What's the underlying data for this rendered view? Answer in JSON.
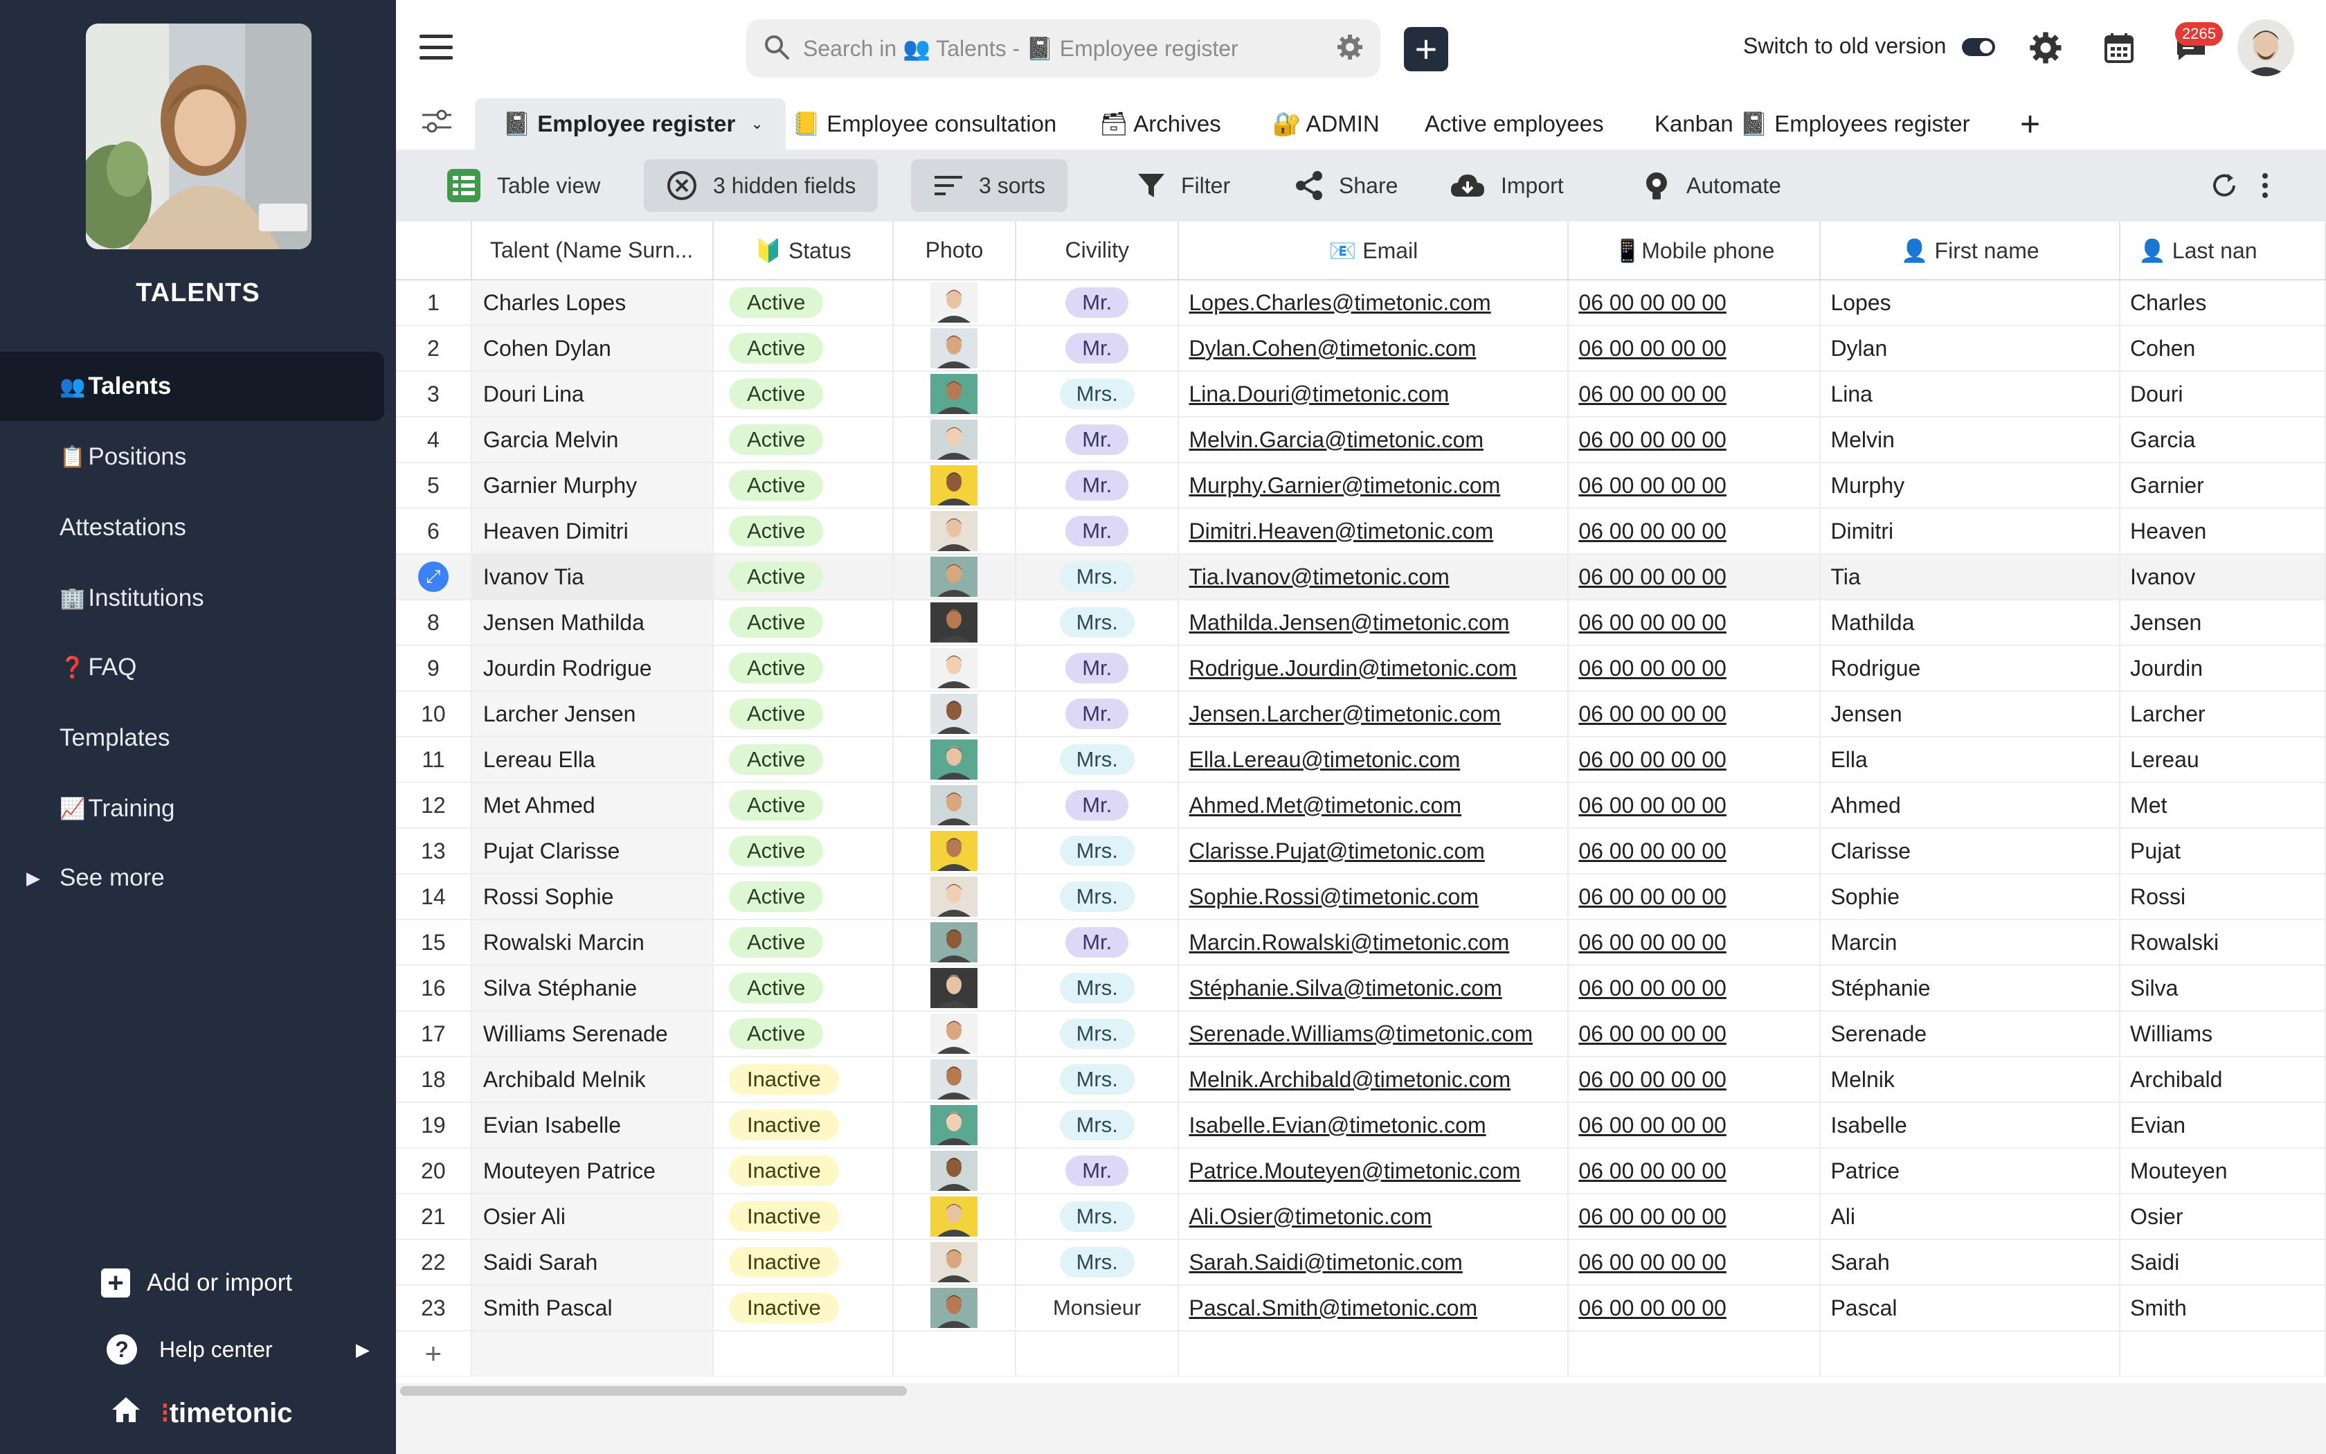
{
  "sidebar": {
    "app_title": "TALENTS",
    "items": [
      {
        "emoji": "👥",
        "label": "Talents"
      },
      {
        "emoji": "📋",
        "label": "Positions"
      },
      {
        "emoji": "",
        "label": "Attestations"
      },
      {
        "emoji": "🏢",
        "label": "Institutions"
      },
      {
        "emoji": "❓",
        "label": "FAQ"
      },
      {
        "emoji": "",
        "label": "Templates"
      },
      {
        "emoji": "📈",
        "label": "Training"
      },
      {
        "emoji": "",
        "label": "See more"
      }
    ],
    "add_import_label": "Add or import",
    "help_center_label": "Help center",
    "brand": "timetonic"
  },
  "header": {
    "search_placeholder": "Search in 👥 Talents - 📓 Employee register",
    "switch_label": "Switch to old version",
    "notification_count": "2265"
  },
  "tabs": [
    {
      "label": "📓 Employee register"
    },
    {
      "label": "📒 Employee consultation"
    },
    {
      "label": "🗃 Archives"
    },
    {
      "label": "🔐 ADMIN"
    },
    {
      "label": "Active employees"
    },
    {
      "label": "Kanban 📓 Employees register"
    }
  ],
  "toolbar": {
    "table_view": "Table view",
    "hidden_fields": "3 hidden fields",
    "sorts": "3 sorts",
    "filter": "Filter",
    "share": "Share",
    "import": "Import",
    "automate": "Automate"
  },
  "table": {
    "columns": [
      "Talent (Name Surn...",
      "🔰 Status",
      "Photo",
      "Civility",
      "📧 Email",
      "📱Mobile phone",
      "👤 First name",
      "👤 Last nan"
    ],
    "rows": [
      {
        "n": "1",
        "name": "Charles Lopes",
        "status": "Active",
        "civility": "Mr.",
        "email": "Lopes.Charles@timetonic.com",
        "phone": "06 00 00 00 00",
        "first": "Lopes",
        "last": "Charles"
      },
      {
        "n": "2",
        "name": "Cohen Dylan",
        "status": "Active",
        "civility": "Mr.",
        "email": "Dylan.Cohen@timetonic.com",
        "phone": "06 00 00 00 00",
        "first": "Dylan",
        "last": "Cohen"
      },
      {
        "n": "3",
        "name": "Douri Lina",
        "status": "Active",
        "civility": "Mrs.",
        "email": "Lina.Douri@timetonic.com",
        "phone": "06 00 00 00 00",
        "first": "Lina",
        "last": "Douri"
      },
      {
        "n": "4",
        "name": "Garcia Melvin",
        "status": "Active",
        "civility": "Mr.",
        "email": "Melvin.Garcia@timetonic.com",
        "phone": "06 00 00 00 00",
        "first": "Melvin",
        "last": "Garcia"
      },
      {
        "n": "5",
        "name": "Garnier Murphy",
        "status": "Active",
        "civility": "Mr.",
        "email": "Murphy.Garnier@timetonic.com",
        "phone": "06 00 00 00 00",
        "first": "Murphy",
        "last": "Garnier"
      },
      {
        "n": "6",
        "name": "Heaven Dimitri",
        "status": "Active",
        "civility": "Mr.",
        "email": "Dimitri.Heaven@timetonic.com",
        "phone": "06 00 00 00 00",
        "first": "Dimitri",
        "last": "Heaven"
      },
      {
        "n": "",
        "name": "Ivanov Tia",
        "status": "Active",
        "civility": "Mrs.",
        "email": "Tia.Ivanov@timetonic.com",
        "phone": "06 00 00 00 00",
        "first": "Tia",
        "last": "Ivanov",
        "highlight": true
      },
      {
        "n": "8",
        "name": "Jensen Mathilda",
        "status": "Active",
        "civility": "Mrs.",
        "email": "Mathilda.Jensen@timetonic.com",
        "phone": "06 00 00 00 00",
        "first": "Mathilda",
        "last": "Jensen"
      },
      {
        "n": "9",
        "name": "Jourdin Rodrigue",
        "status": "Active",
        "civility": "Mr.",
        "email": "Rodrigue.Jourdin@timetonic.com",
        "phone": "06 00 00 00 00",
        "first": "Rodrigue",
        "last": "Jourdin"
      },
      {
        "n": "10",
        "name": "Larcher Jensen",
        "status": "Active",
        "civility": "Mr.",
        "email": "Jensen.Larcher@timetonic.com",
        "phone": "06 00 00 00 00",
        "first": "Jensen",
        "last": "Larcher"
      },
      {
        "n": "11",
        "name": "Lereau Ella",
        "status": "Active",
        "civility": "Mrs.",
        "email": "Ella.Lereau@timetonic.com",
        "phone": "06 00 00 00 00",
        "first": "Ella",
        "last": "Lereau"
      },
      {
        "n": "12",
        "name": "Met Ahmed",
        "status": "Active",
        "civility": "Mr.",
        "email": "Ahmed.Met@timetonic.com",
        "phone": "06 00 00 00 00",
        "first": "Ahmed",
        "last": "Met"
      },
      {
        "n": "13",
        "name": "Pujat Clarisse",
        "status": "Active",
        "civility": "Mrs.",
        "email": "Clarisse.Pujat@timetonic.com",
        "phone": "06 00 00 00 00",
        "first": "Clarisse",
        "last": "Pujat"
      },
      {
        "n": "14",
        "name": "Rossi Sophie",
        "status": "Active",
        "civility": "Mrs.",
        "email": "Sophie.Rossi@timetonic.com",
        "phone": "06 00 00 00 00",
        "first": "Sophie",
        "last": "Rossi"
      },
      {
        "n": "15",
        "name": "Rowalski Marcin",
        "status": "Active",
        "civility": "Mr.",
        "email": "Marcin.Rowalski@timetonic.com",
        "phone": "06 00 00 00 00",
        "first": "Marcin",
        "last": "Rowalski"
      },
      {
        "n": "16",
        "name": "Silva Stéphanie",
        "status": "Active",
        "civility": "Mrs.",
        "email": "Stéphanie.Silva@timetonic.com",
        "phone": "06 00 00 00 00",
        "first": "Stéphanie",
        "last": "Silva"
      },
      {
        "n": "17",
        "name": "Williams Serenade",
        "status": "Active",
        "civility": "Mrs.",
        "email": "Serenade.Williams@timetonic.com",
        "phone": "06 00 00 00 00",
        "first": "Serenade",
        "last": "Williams"
      },
      {
        "n": "18",
        "name": "Archibald Melnik",
        "status": "Inactive",
        "civility": "Mrs.",
        "email": "Melnik.Archibald@timetonic.com",
        "phone": "06 00 00 00 00",
        "first": "Melnik",
        "last": "Archibald"
      },
      {
        "n": "19",
        "name": "Evian Isabelle",
        "status": "Inactive",
        "civility": "Mrs.",
        "email": "Isabelle.Evian@timetonic.com",
        "phone": "06 00 00 00 00",
        "first": "Isabelle",
        "last": "Evian"
      },
      {
        "n": "20",
        "name": "Mouteyen Patrice",
        "status": "Inactive",
        "civility": "Mr.",
        "email": "Patrice.Mouteyen@timetonic.com",
        "phone": "06 00 00 00 00",
        "first": "Patrice",
        "last": "Mouteyen"
      },
      {
        "n": "21",
        "name": "Osier Ali",
        "status": "Inactive",
        "civility": "Mrs.",
        "email": "Ali.Osier@timetonic.com",
        "phone": "06 00 00 00 00",
        "first": "Ali",
        "last": "Osier"
      },
      {
        "n": "22",
        "name": "Saidi Sarah",
        "status": "Inactive",
        "civility": "Mrs.",
        "email": "Sarah.Saidi@timetonic.com",
        "phone": "06 00 00 00 00",
        "first": "Sarah",
        "last": "Saidi"
      },
      {
        "n": "23",
        "name": "Smith Pascal",
        "status": "Inactive",
        "civility": "Monsieur",
        "email": "Pascal.Smith@timetonic.com",
        "phone": "06 00 00 00 00",
        "first": "Pascal",
        "last": "Smith"
      }
    ]
  },
  "colors": {
    "sidebar_bg": "#232d3d",
    "active_status_bg": "#def7d3",
    "inactive_status_bg": "#fdf8c6",
    "mr_bg": "#dcd8f5",
    "mrs_bg": "#dff3f8",
    "accent_blue": "#3b82f6"
  }
}
